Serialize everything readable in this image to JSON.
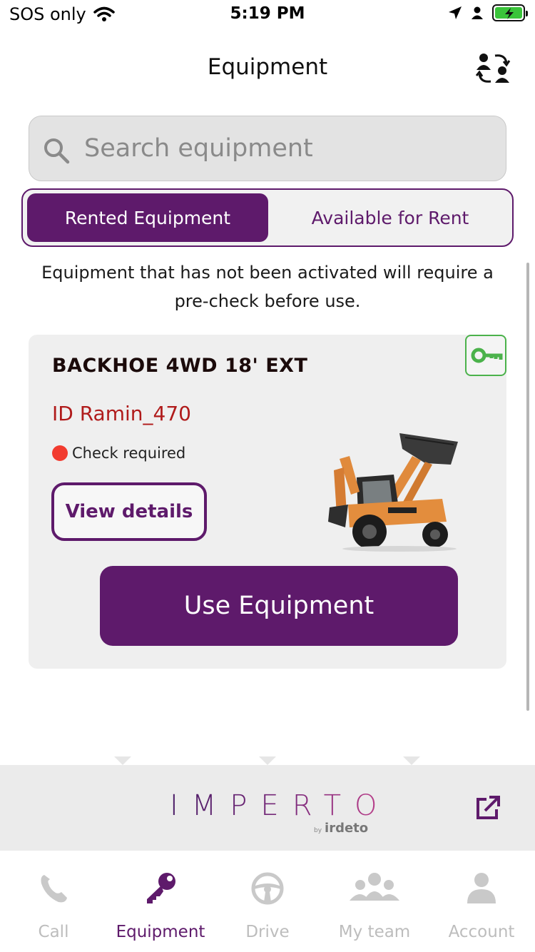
{
  "status_bar": {
    "carrier": "SOS only",
    "time": "5:19 PM"
  },
  "header": {
    "title": "Equipment"
  },
  "search": {
    "placeholder": "Search equipment"
  },
  "segments": {
    "active": "Rented Equipment",
    "inactive": "Available for Rent"
  },
  "notice": "Equipment that has not been activated will require a pre-check before use.",
  "card": {
    "title": "BACKHOE 4WD 18' EXT",
    "id": "ID Ramin_470",
    "status": "Check required",
    "status_color": "#f23b2f",
    "view_details": "View details",
    "use_button": "Use Equipment",
    "key_icon_color": "#4bb24b"
  },
  "brand": {
    "logo": "IMPERTO",
    "by": "by",
    "sub": "irdeto"
  },
  "tabs": [
    {
      "label": "Call",
      "icon": "phone-icon",
      "active": false
    },
    {
      "label": "Equipment",
      "icon": "key-icon",
      "active": true
    },
    {
      "label": "Drive",
      "icon": "steering-wheel-icon",
      "active": false
    },
    {
      "label": "My team",
      "icon": "team-icon",
      "active": false
    },
    {
      "label": "Account",
      "icon": "person-icon",
      "active": false
    }
  ],
  "colors": {
    "accent": "#5e1a6b",
    "id_red": "#b01b1b",
    "inactive_tab": "#bdbdbd"
  }
}
